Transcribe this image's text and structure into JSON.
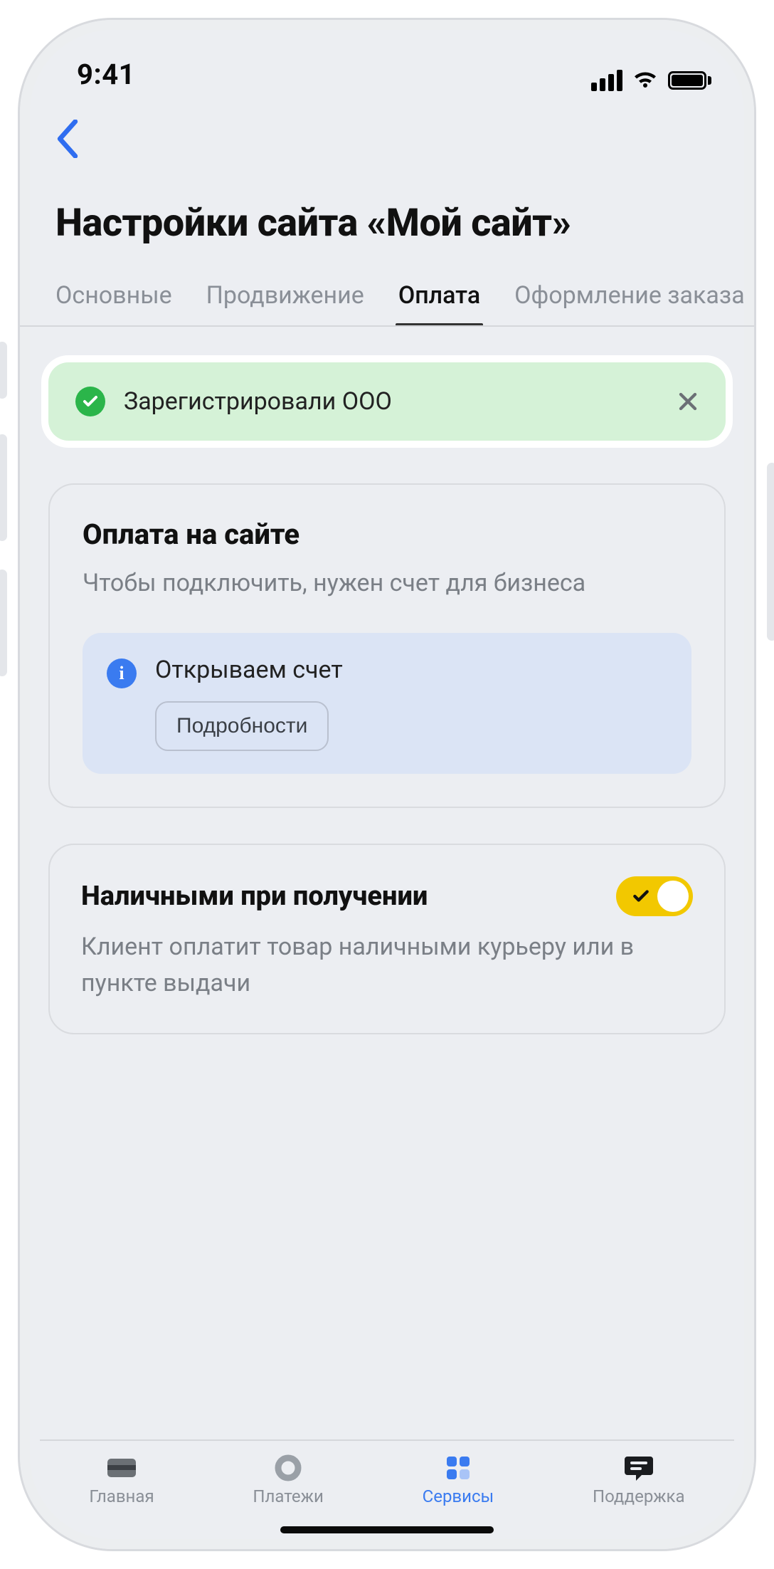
{
  "status": {
    "time": "9:41"
  },
  "page": {
    "title": "Настройки сайта «Мой сайт»"
  },
  "tabs": [
    {
      "label": "Основные"
    },
    {
      "label": "Продвижение"
    },
    {
      "label": "Оплата"
    },
    {
      "label": "Оформление заказа"
    }
  ],
  "toast": {
    "text": "Зарегистрировали ООО"
  },
  "payment_card": {
    "title": "Оплата на сайте",
    "subtitle": "Чтобы подключить, нужен счет для бизнеса",
    "info_text": "Открываем счет",
    "details_label": "Подробности"
  },
  "cash_card": {
    "title": "Наличными при получении",
    "subtitle": "Клиент оплатит товар наличными курьеру или в пункте выдачи",
    "toggle_on": true
  },
  "bottom_tabs": [
    {
      "label": "Главная"
    },
    {
      "label": "Платежи"
    },
    {
      "label": "Сервисы"
    },
    {
      "label": "Поддержка"
    }
  ]
}
